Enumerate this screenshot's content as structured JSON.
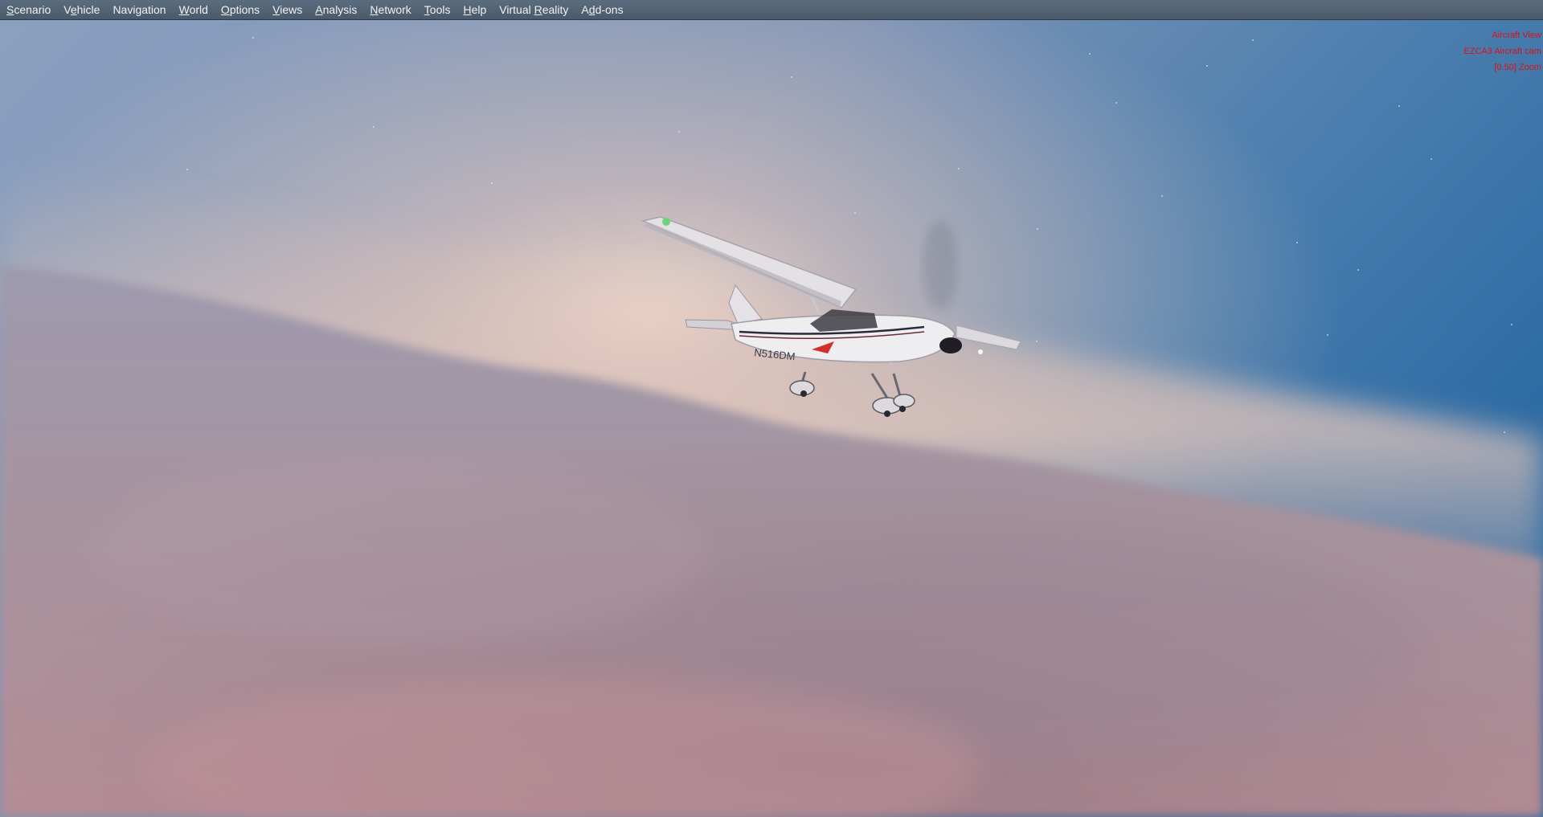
{
  "menu": {
    "items": [
      {
        "label": "Scenario",
        "accel": "S"
      },
      {
        "label": "Vehicle",
        "accel": "e"
      },
      {
        "label": "Navigation",
        "accel": ""
      },
      {
        "label": "World",
        "accel": "W"
      },
      {
        "label": "Options",
        "accel": "O"
      },
      {
        "label": "Views",
        "accel": "V"
      },
      {
        "label": "Analysis",
        "accel": "A"
      },
      {
        "label": "Network",
        "accel": "N"
      },
      {
        "label": "Tools",
        "accel": "T"
      },
      {
        "label": "Help",
        "accel": "H"
      },
      {
        "label": "Virtual Reality",
        "accel": "R"
      },
      {
        "label": "Add-ons",
        "accel": "d"
      }
    ],
    "text_color": "#f2f2f2",
    "background": "#52647a"
  },
  "overlay": {
    "color": "#e01010",
    "lines": [
      "Aircraft View",
      "EZCA3 Aircraft cam",
      "[0.50] Zoom"
    ]
  },
  "scene": {
    "aircraft_registration": "N516DM",
    "aircraft-icon": "cessna-172-illustration",
    "sky_colors": {
      "top_right": "#2f6ea6",
      "top_left": "#7f97b8",
      "horizon_glow": "#f0d4c4"
    },
    "cloud_colors": {
      "upper": "#a39aa8",
      "lower": "#b8939a"
    }
  }
}
